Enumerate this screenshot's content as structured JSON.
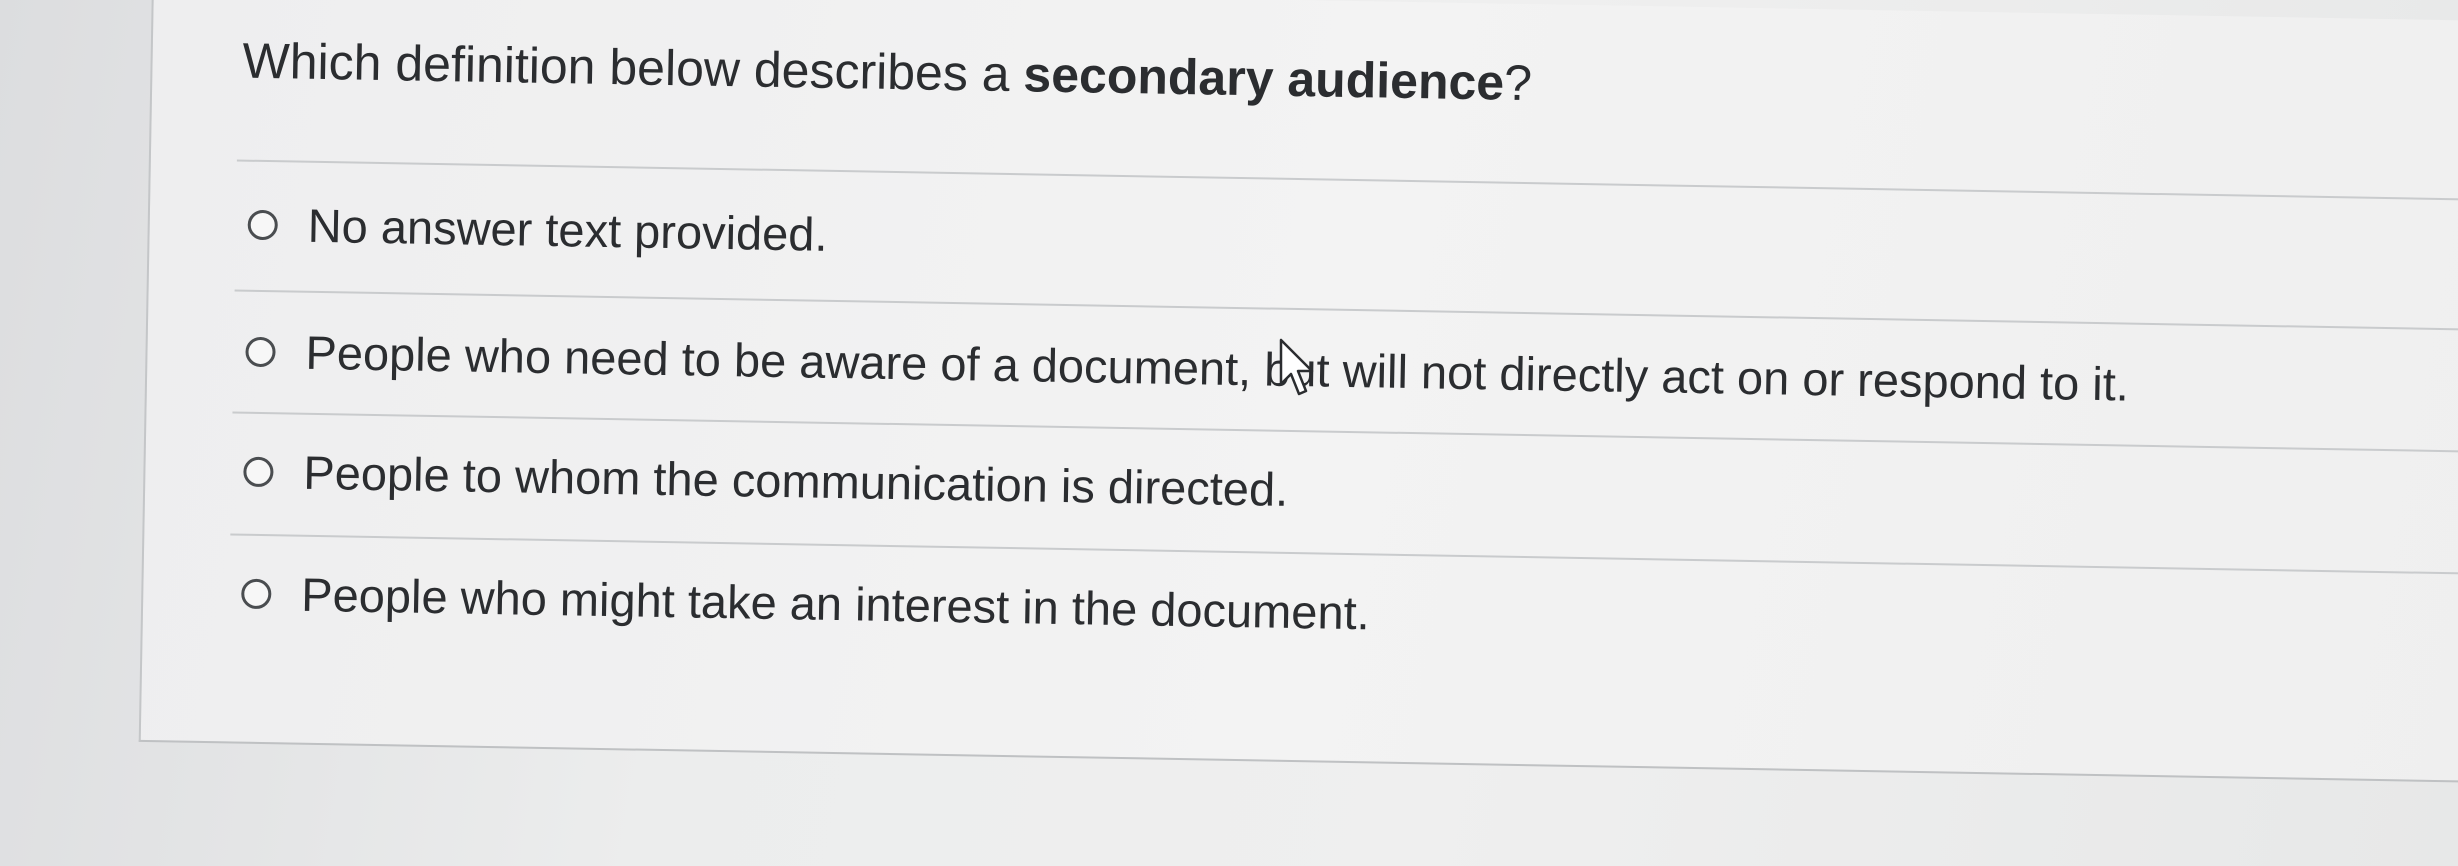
{
  "question": {
    "prefix": "Which definition below describes a ",
    "emphasis": "secondary audience",
    "suffix": "?"
  },
  "options": [
    {
      "label": "No answer text provided.",
      "selected": false
    },
    {
      "label": "People who need to be aware of a document, but will not directly act on or respond to it.",
      "selected": false
    },
    {
      "label": "People to whom the communication is directed.",
      "selected": false
    },
    {
      "label": "People who might take an interest in the document.",
      "selected": false
    }
  ],
  "icons": {
    "cursor": "mouse-pointer-icon",
    "radio": "radio-button-icon"
  },
  "colors": {
    "text": "#2b2d30",
    "radio_border": "#4a4d50",
    "divider": "#c9cbcd"
  }
}
